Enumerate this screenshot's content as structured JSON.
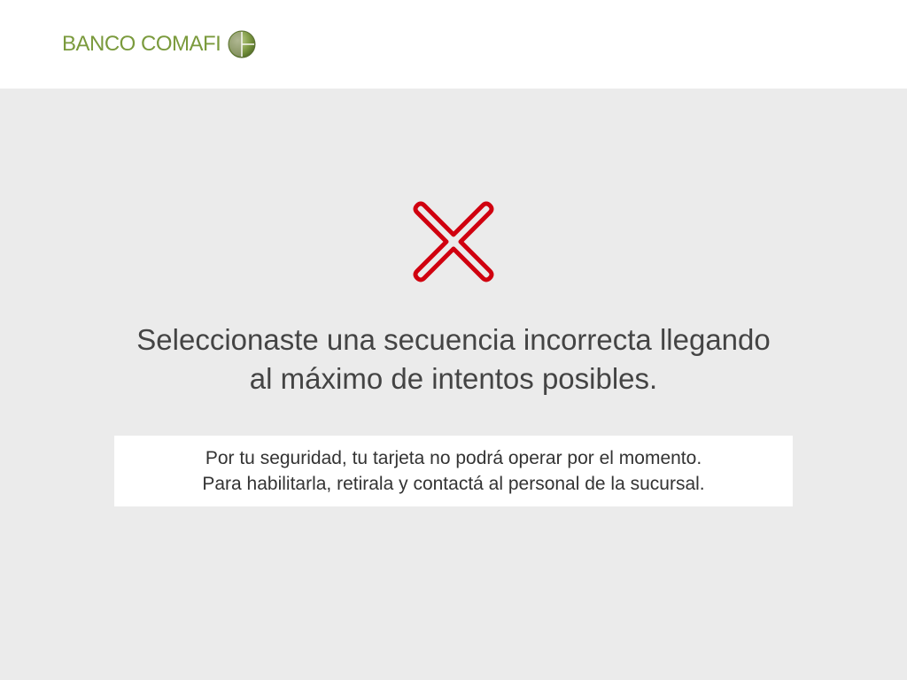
{
  "header": {
    "brand_name": "BANCO COMAFI",
    "brand_icon": "comafi-globe-icon",
    "brand_color": "#7a9a3c"
  },
  "error": {
    "icon": "error-x-icon",
    "icon_color": "#d0000f",
    "title_line1": "Seleccionaste una secuencia incorrecta llegando",
    "title_line2": "al máximo de intentos posibles."
  },
  "message": {
    "line1": "Por tu seguridad, tu tarjeta no podrá operar por el momento.",
    "line2": "Para habilitarla, retirala y contactá al personal de la sucursal."
  }
}
